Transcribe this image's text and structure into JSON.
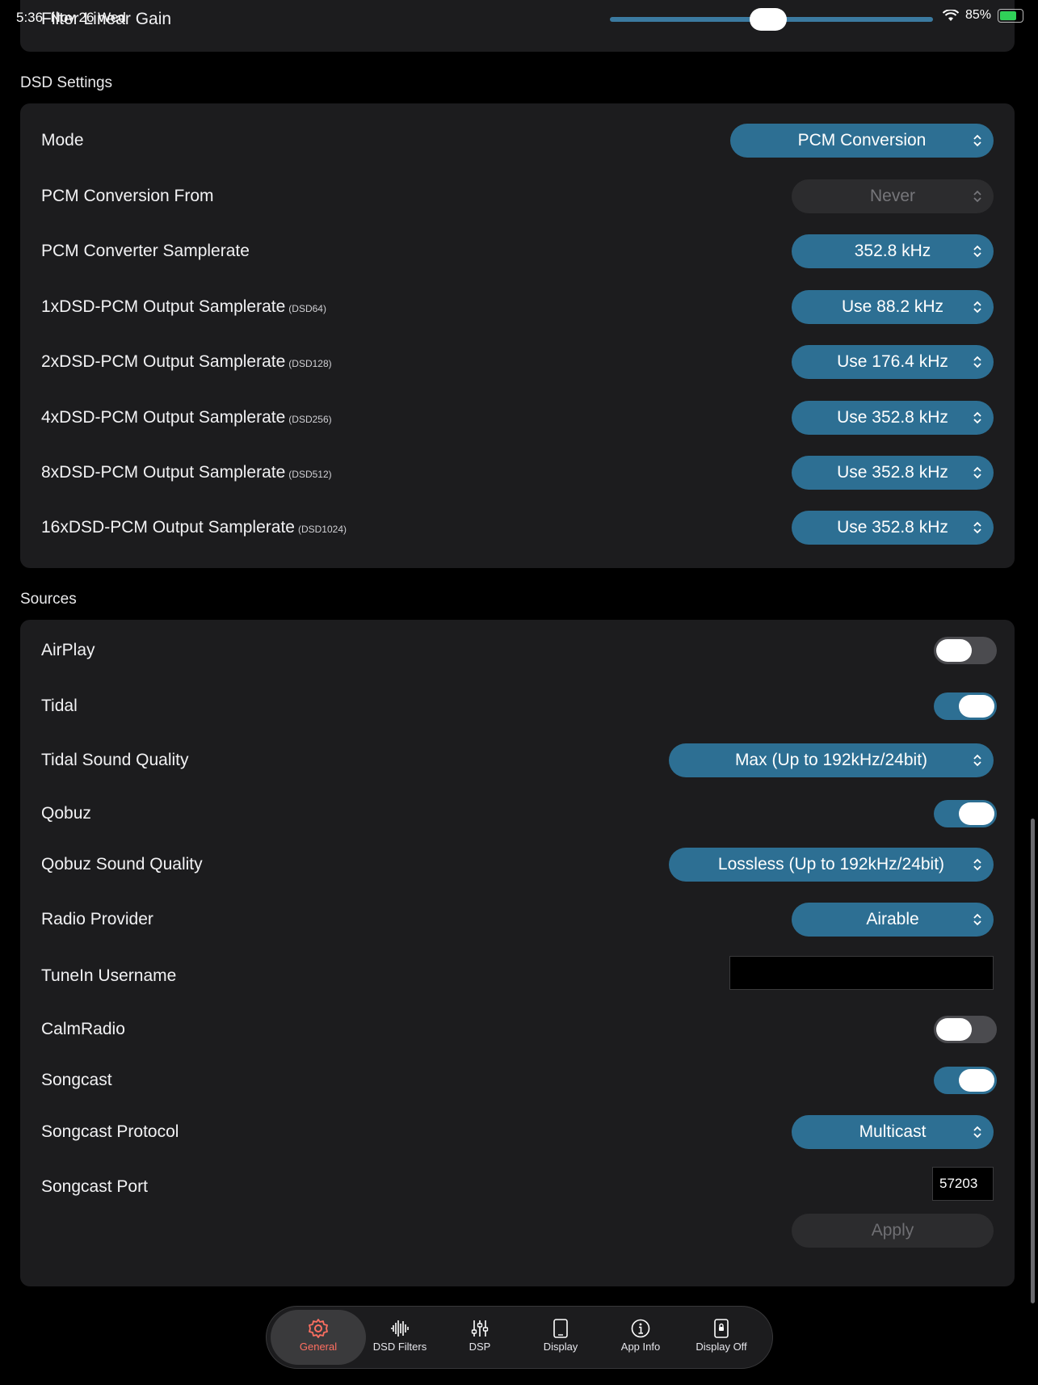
{
  "status_bar": {
    "time": "5:36",
    "date": "Nov 26 Wed",
    "battery": "85%",
    "battery_level": 0.85
  },
  "top_partial": {
    "label": "Filter Linear Gain",
    "slider_value": 0.49
  },
  "dsd": {
    "section_title": "DSD Settings",
    "rows": [
      {
        "label": "Mode",
        "sub": "",
        "value": "PCM Conversion",
        "disabled": false
      },
      {
        "label": "PCM Conversion From",
        "sub": "",
        "value": "Never",
        "disabled": true
      },
      {
        "label": "PCM Converter Samplerate",
        "sub": "",
        "value": "352.8 kHz",
        "disabled": false
      },
      {
        "label": "1xDSD-PCM Output Samplerate",
        "sub": "(DSD64)",
        "value": "Use 88.2 kHz",
        "disabled": false
      },
      {
        "label": "2xDSD-PCM Output Samplerate",
        "sub": "(DSD128)",
        "value": "Use 176.4 kHz",
        "disabled": false
      },
      {
        "label": "4xDSD-PCM Output Samplerate",
        "sub": "(DSD256)",
        "value": "Use 352.8 kHz",
        "disabled": false
      },
      {
        "label": "8xDSD-PCM Output Samplerate",
        "sub": "(DSD512)",
        "value": "Use 352.8 kHz",
        "disabled": false
      },
      {
        "label": "16xDSD-PCM Output Samplerate",
        "sub": "(DSD1024)",
        "value": "Use 352.8 kHz",
        "disabled": false
      }
    ]
  },
  "sources": {
    "section_title": "Sources",
    "airplay": {
      "label": "AirPlay",
      "on": false
    },
    "tidal": {
      "label": "Tidal",
      "on": true
    },
    "tidal_quality": {
      "label": "Tidal Sound Quality",
      "value": "Max (Up to 192kHz/24bit)"
    },
    "qobuz": {
      "label": "Qobuz",
      "on": true
    },
    "qobuz_quality": {
      "label": "Qobuz Sound Quality",
      "value": "Lossless (Up to 192kHz/24bit)"
    },
    "radio_provider": {
      "label": "Radio Provider",
      "value": "Airable"
    },
    "tunein": {
      "label": "TuneIn Username",
      "value": ""
    },
    "calmradio": {
      "label": "CalmRadio",
      "on": false
    },
    "songcast": {
      "label": "Songcast",
      "on": true
    },
    "songcast_protocol": {
      "label": "Songcast Protocol",
      "value": "Multicast"
    },
    "songcast_port": {
      "label": "Songcast Port",
      "value": "57203"
    },
    "apply": "Apply"
  },
  "tabs": [
    {
      "label": "General",
      "icon": "gear-icon",
      "active": true
    },
    {
      "label": "DSD Filters",
      "icon": "waveform-icon",
      "active": false
    },
    {
      "label": "DSP",
      "icon": "sliders-icon",
      "active": false
    },
    {
      "label": "Display",
      "icon": "tablet-icon",
      "active": false
    },
    {
      "label": "App Info",
      "icon": "info-icon",
      "active": false
    },
    {
      "label": "Display Off",
      "icon": "lock-screen-icon",
      "active": false
    }
  ],
  "colors": {
    "accent": "#2d6f93",
    "active_tab": "#ff6f61",
    "card": "#1c1c1e",
    "background": "#000000"
  }
}
